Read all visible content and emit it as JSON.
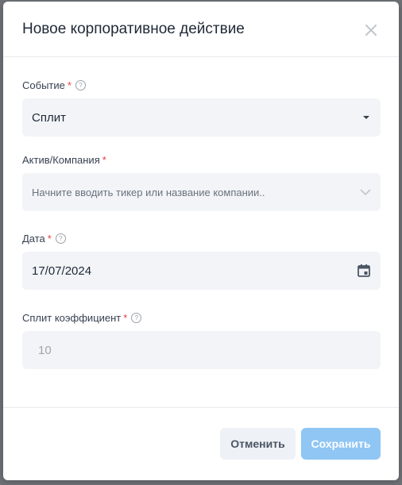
{
  "modal": {
    "title": "Новое корпоративное действие"
  },
  "fields": {
    "event": {
      "label": "Событие",
      "required": "*",
      "help": "?",
      "value": "Сплит"
    },
    "asset": {
      "label": "Актив/Компания",
      "required": "*",
      "placeholder": "Начните вводить тикер или название компании.."
    },
    "date": {
      "label": "Дата",
      "required": "*",
      "help": "?",
      "value": "17/07/2024"
    },
    "split": {
      "label": "Сплит коэффициент",
      "required": "*",
      "help": "?",
      "value": "10"
    }
  },
  "footer": {
    "cancel_label": "Отменить",
    "save_label": "Сохранить"
  },
  "colors": {
    "primary_disabled": "#8fc6f3",
    "required": "#e53e3e",
    "field_bg": "#f2f4f7"
  },
  "icons": {
    "close": "close-icon",
    "dropdown": "caret-down-icon",
    "chevron": "chevron-down-icon",
    "calendar": "calendar-icon",
    "help": "help-icon"
  }
}
